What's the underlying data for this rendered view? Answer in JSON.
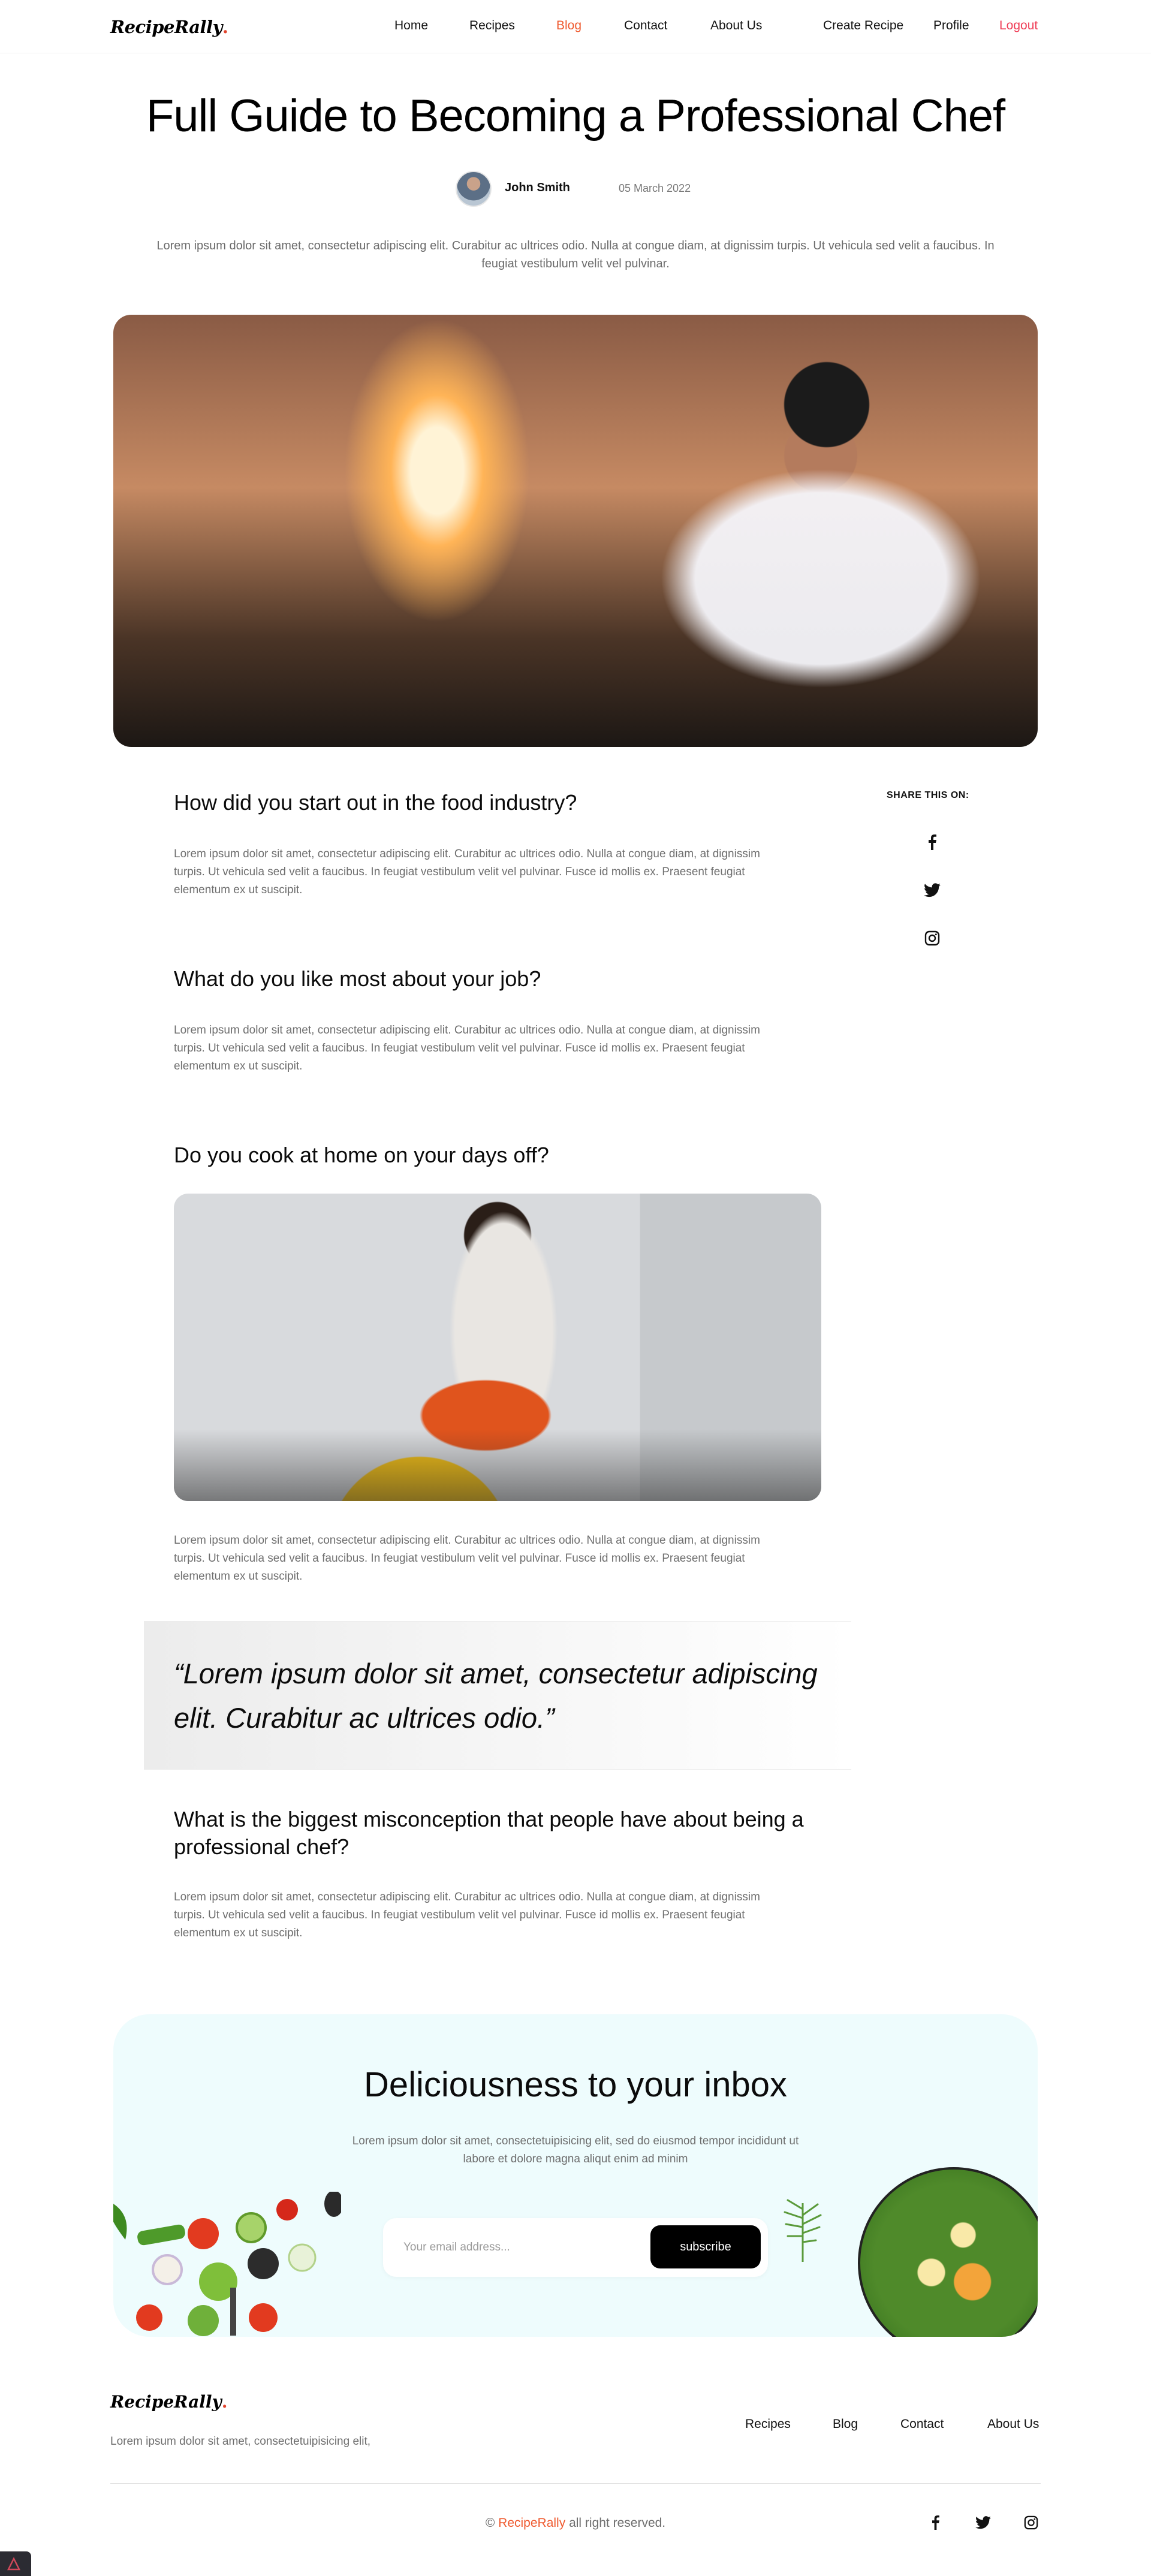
{
  "header": {
    "logo": "RecipeRally",
    "nav": [
      "Home",
      "Recipes",
      "Blog",
      "Contact",
      "About Us"
    ],
    "active_nav": "Blog",
    "right": [
      "Create Recipe",
      "Profile",
      "Logout"
    ]
  },
  "hero": {
    "title": "Full Guide to Becoming a Professional Chef",
    "author": "John Smith",
    "date": "05 March 2022",
    "intro": "Lorem ipsum dolor sit amet, consectetur adipiscing elit. Curabitur ac ultrices odio. Nulla at congue diam, at dignissim turpis. Ut vehicula sed velit a faucibus. In feugiat vestibulum velit vel pulvinar."
  },
  "share": {
    "label": "SHARE THIS ON:",
    "icons": [
      "facebook-icon",
      "twitter-icon",
      "instagram-icon"
    ]
  },
  "article": {
    "sections": [
      {
        "heading": "How did you start out in the food industry?",
        "body": "Lorem ipsum dolor sit amet, consectetur adipiscing elit. Curabitur ac ultrices odio. Nulla at congue diam, at dignissim turpis. Ut vehicula sed velit a faucibus. In feugiat vestibulum velit vel pulvinar. Fusce id mollis ex. Praesent feugiat elementum ex ut suscipit."
      },
      {
        "heading": "What do you like most about your job?",
        "body": "Lorem ipsum dolor sit amet, consectetur adipiscing elit. Curabitur ac ultrices odio. Nulla at congue diam, at dignissim turpis. Ut vehicula sed velit a faucibus. In feugiat vestibulum velit vel pulvinar. Fusce id mollis ex. Praesent feugiat elementum ex ut suscipit."
      },
      {
        "heading": "Do you cook at home on your days off?",
        "body": "Lorem ipsum dolor sit amet, consectetur adipiscing elit. Curabitur ac ultrices odio. Nulla at congue diam, at dignissim turpis. Ut vehicula sed velit a faucibus. In feugiat vestibulum velit vel pulvinar. Fusce id mollis ex. Praesent feugiat elementum ex ut suscipit."
      },
      {
        "heading": "What is the biggest misconception that people have about being a professional chef?",
        "body": "Lorem ipsum dolor sit amet, consectetur adipiscing elit. Curabitur ac ultrices odio. Nulla at congue diam, at dignissim turpis. Ut vehicula sed velit a faucibus. In feugiat vestibulum velit vel pulvinar. Fusce id mollis ex. Praesent feugiat elementum ex ut suscipit."
      }
    ],
    "quote": "“Lorem ipsum dolor sit amet, consectetur adipiscing elit. Curabitur ac ultrices odio.”"
  },
  "newsletter": {
    "title": "Deliciousness to your inbox",
    "text": "Lorem ipsum dolor sit amet, consectetuipisicing elit, sed do eiusmod tempor incididunt ut labore et dolore magna aliqut enim ad minim",
    "placeholder": "Your email address...",
    "button": "subscribe"
  },
  "footer": {
    "logo": "RecipeRally",
    "text": "Lorem ipsum dolor sit amet, consectetuipisicing elit,",
    "nav": [
      "Recipes",
      "Blog",
      "Contact",
      "About Us"
    ],
    "copyright_prefix": "©",
    "brand": "RecipeRally",
    "copyright_suffix": "all right reserved.",
    "icons": [
      "facebook-icon",
      "twitter-icon",
      "instagram-icon"
    ]
  },
  "colors": {
    "accent": "#ef5a2f",
    "logout": "#ef3d56",
    "newsletter_bg": "#eefcfd"
  }
}
